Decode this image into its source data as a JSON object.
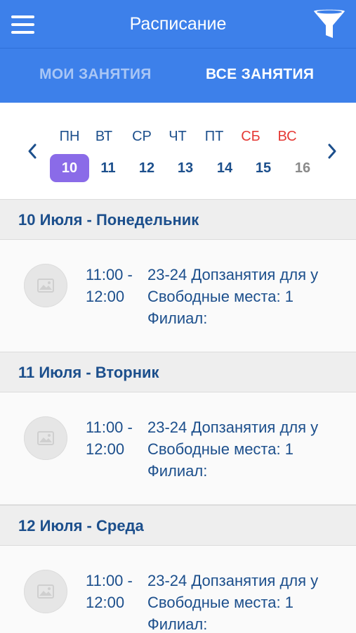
{
  "header": {
    "title": "Расписание",
    "menu_icon": "hamburger-menu-icon",
    "filter_icon": "funnel-filter-icon",
    "color": "#3d80ea"
  },
  "tabs": [
    {
      "label": "МОИ ЗАНЯТИЯ",
      "active": false
    },
    {
      "label": "ВСЕ ЗАНЯТИЯ",
      "active": true
    }
  ],
  "calendar": {
    "weekdays": [
      "ПН",
      "ВТ",
      "СР",
      "ЧТ",
      "ПТ",
      "СБ",
      "ВС"
    ],
    "days": [
      "10",
      "11",
      "12",
      "13",
      "14",
      "15",
      "16"
    ],
    "selected_index": 0,
    "weekend_color": "#e53935",
    "selected_color": "#8a6be8"
  },
  "schedule": [
    {
      "header": "10 Июля - Понедельник",
      "lesson": {
        "time_start": "11:00 -",
        "time_end": "12:00",
        "name": "23-24 Допзанятия для у",
        "free_places": "Свободные места: 1",
        "branch": "Филиал:"
      }
    },
    {
      "header": "11 Июля - Вторник",
      "lesson": {
        "time_start": "11:00 -",
        "time_end": "12:00",
        "name": "23-24 Допзанятия для у",
        "free_places": "Свободные места: 1",
        "branch": "Филиал:"
      }
    },
    {
      "header": "12 Июля - Среда",
      "lesson": {
        "time_start": "11:00 -",
        "time_end": "12:00",
        "name": "23-24 Допзанятия для у",
        "free_places": "Свободные места: 1",
        "branch": "Филиал:"
      }
    }
  ]
}
